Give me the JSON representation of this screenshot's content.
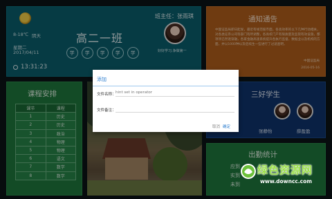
{
  "class_info": {
    "temperature": "8-18℃",
    "weather": "阴天",
    "weekday": "星期二",
    "date": "2017/04/11",
    "time": "13:31:23",
    "class_name": "高二一班",
    "motto_chars": [
      "学",
      "学",
      "学",
      "学",
      "学"
    ],
    "teacher_label": "班主任：张雨琪",
    "teacher_note": "好好学习,争做第一"
  },
  "notice": {
    "title": "通知通告",
    "body": "中国证监局即日起发，最近有规范股市面，各高效率的以下几种行动相关，对各类证券公司等部门有所调整，各高校门户有限质量及监管有效设施，都项项已然逐渐融，各家金融高速系统提升各执行监督，数据业以及机构的方面，并以1000种以及后续生一些进行了过滤查明，",
    "signature": "中国证监局",
    "date": "2016-05-16"
  },
  "schedule": {
    "title": "课程安排",
    "headers": [
      "课节",
      "课程"
    ],
    "rows": [
      [
        "1",
        "历史"
      ],
      [
        "2",
        "历史"
      ],
      [
        "3",
        "政治"
      ],
      [
        "4",
        "物理"
      ],
      [
        "5",
        "物理"
      ],
      [
        "6",
        "语文"
      ],
      [
        "7",
        "数学"
      ],
      [
        "8",
        "数学"
      ]
    ]
  },
  "students": {
    "title": "三好学生",
    "names": [
      "张静怡",
      "薛盈盈"
    ]
  },
  "attendance": {
    "title": "出勤统计",
    "lines": [
      "应到",
      "实到",
      "未到"
    ]
  },
  "dialog": {
    "title": "添加",
    "name_label": "文件名称：",
    "name_hint": "hint set in operator",
    "note_label": "文件备注：",
    "note_value": "",
    "cancel_label": "取消",
    "confirm_label": "确定",
    "accent": "#2f7fd0"
  },
  "watermark": {
    "text": "绿色资源网",
    "url": "www.downcc.com"
  }
}
